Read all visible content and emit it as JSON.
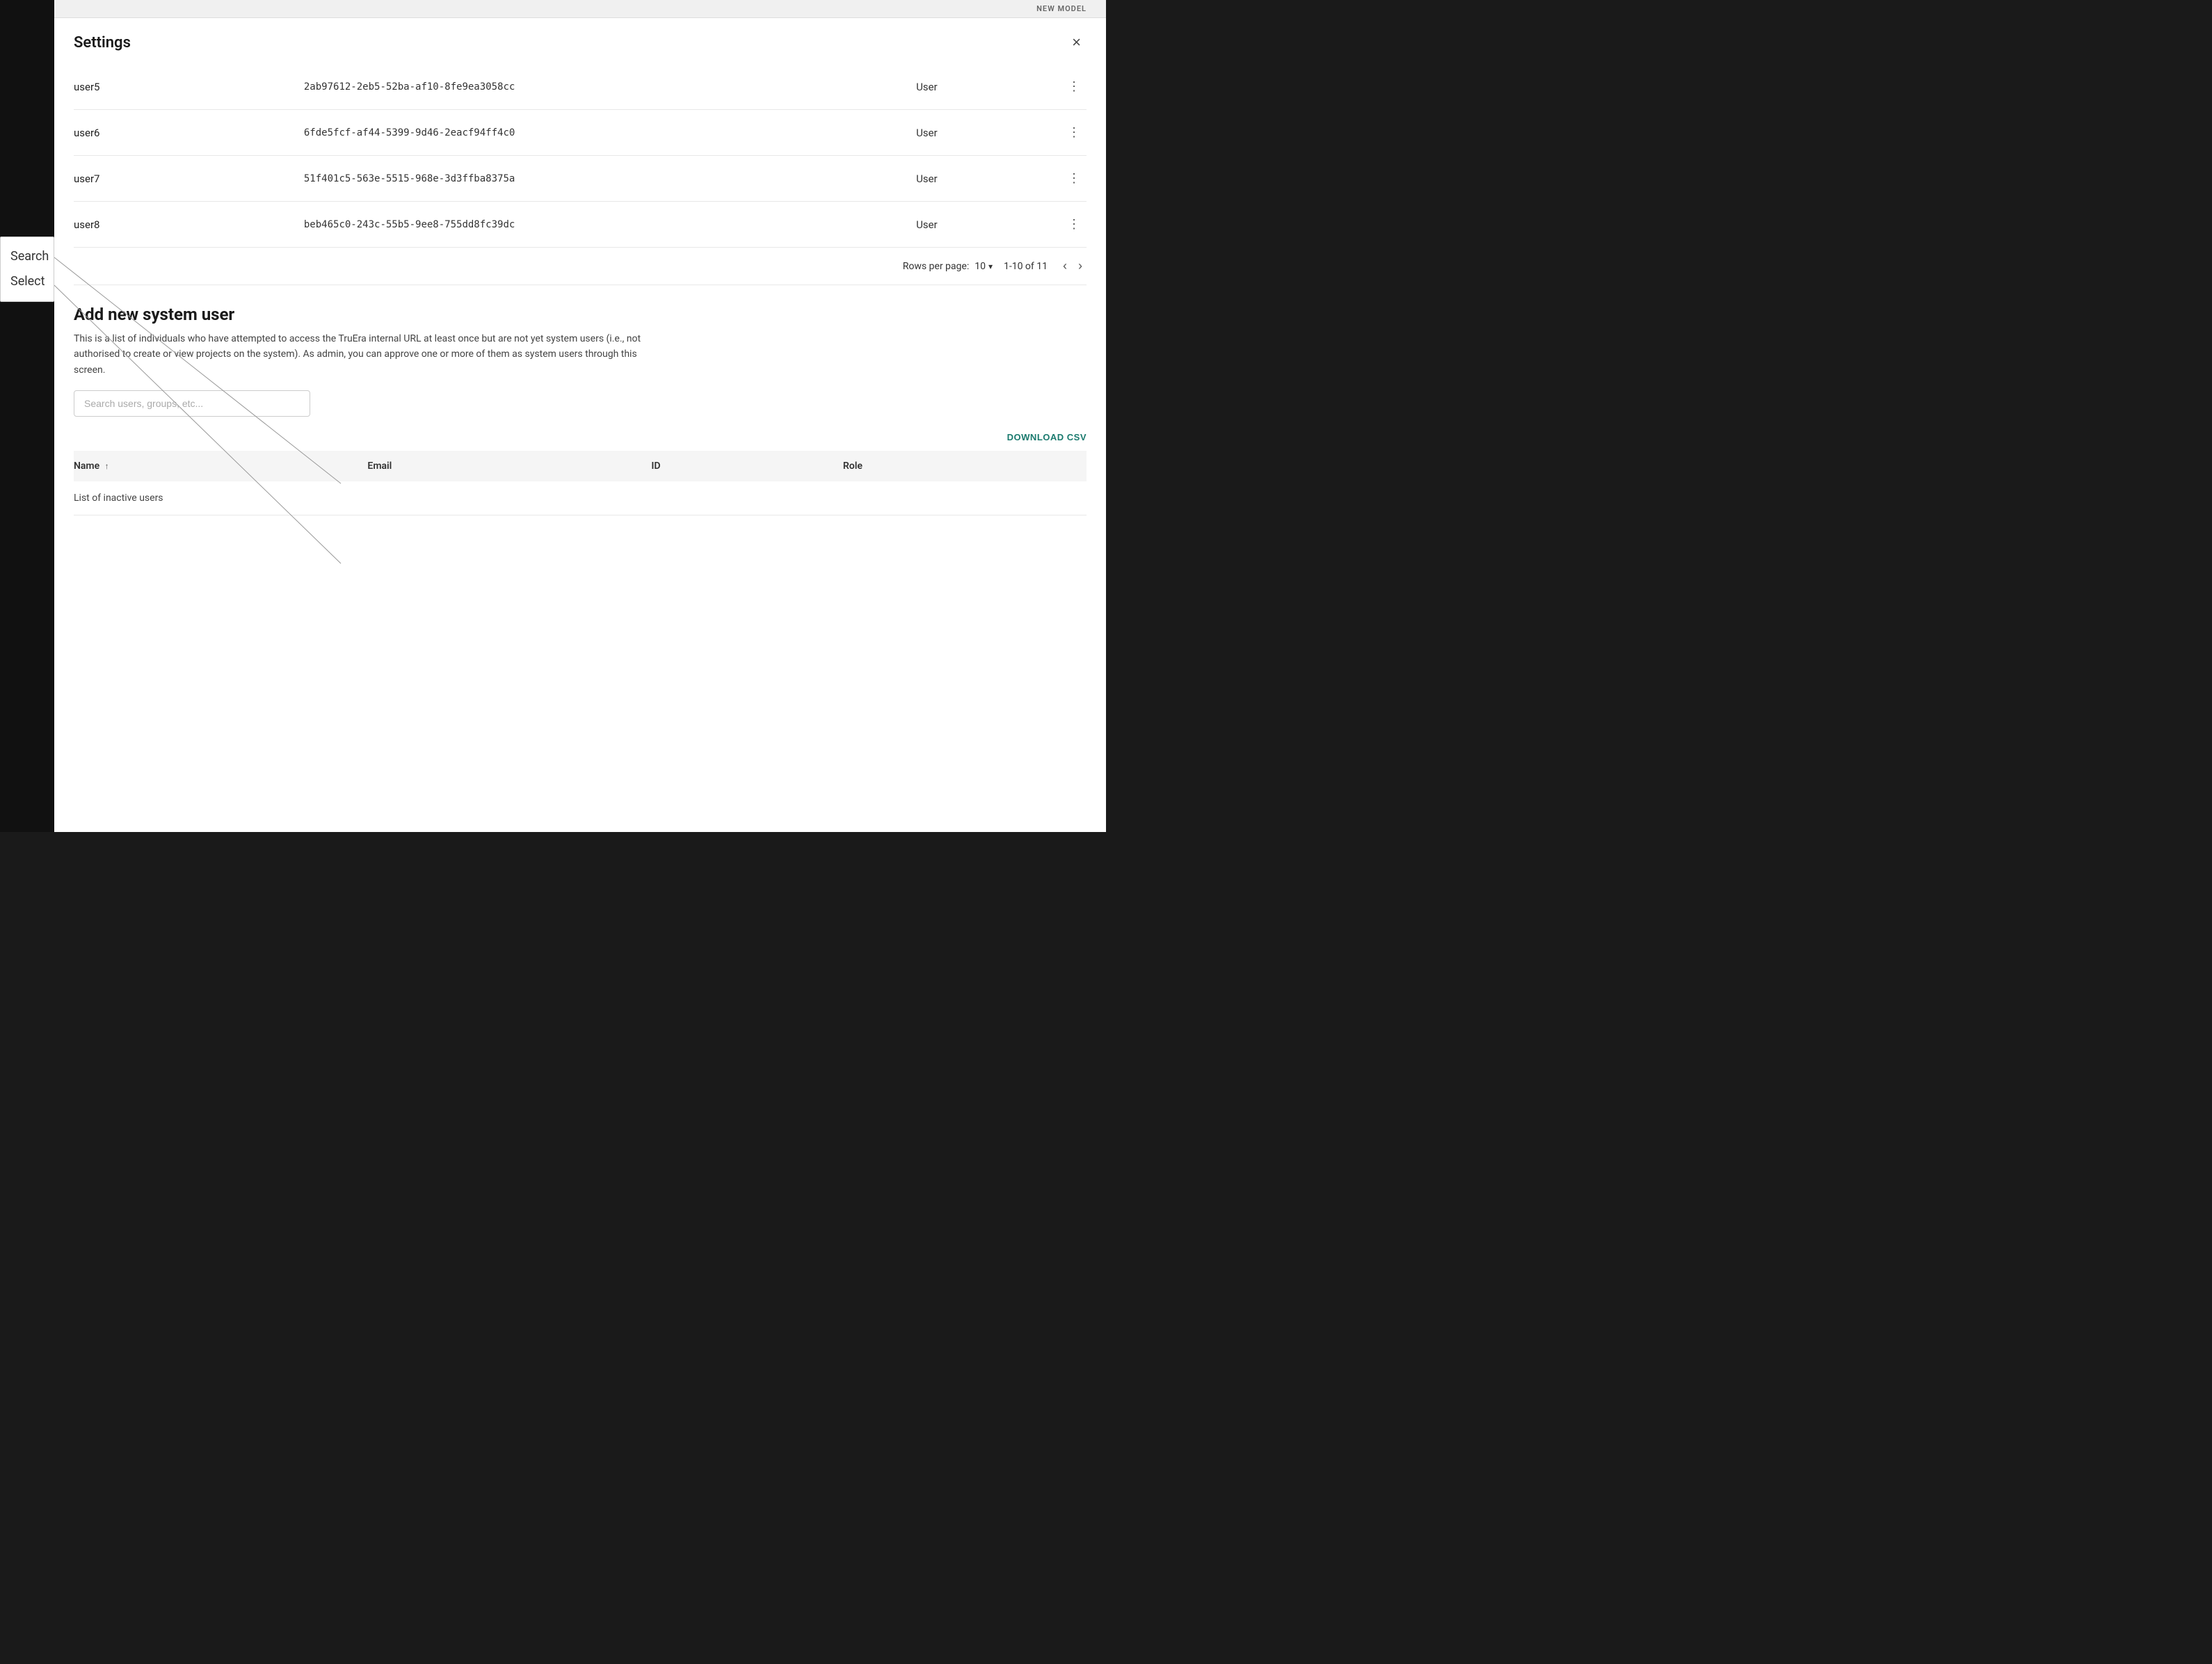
{
  "topbar": {
    "new_model_label": "NEW MODEL"
  },
  "modal": {
    "title": "Settings",
    "close_label": "×"
  },
  "users_table": {
    "rows": [
      {
        "name": "user5",
        "id": "2ab97612-2eb5-52ba-af10-8fe9ea3058cc",
        "role": "User"
      },
      {
        "name": "user6",
        "id": "6fde5fcf-af44-5399-9d46-2eacf94ff4c0",
        "role": "User"
      },
      {
        "name": "user7",
        "id": "51f401c5-563e-5515-968e-3d3ffba8375a",
        "role": "User"
      },
      {
        "name": "user8",
        "id": "beb465c0-243c-55b5-9ee8-755dd8fc39dc",
        "role": "User"
      }
    ]
  },
  "pagination": {
    "rows_per_page_label": "Rows per page:",
    "rows_count": "10",
    "page_info": "1-10 of 11",
    "prev_icon": "‹",
    "next_icon": "›"
  },
  "add_user_section": {
    "title": "Add new system user",
    "description": "This is a list of individuals who have attempted to access the TruEra internal URL at least once but are not yet system users (i.e., not authorised to create or view projects on the system). As admin, you can approve one or more of them as system users through this screen.",
    "search_placeholder": "Search users, groups, etc...",
    "download_csv_label": "DOWNLOAD CSV"
  },
  "inactive_table": {
    "columns": [
      {
        "label": "Name",
        "sort": true
      },
      {
        "label": "Email",
        "sort": false
      },
      {
        "label": "ID",
        "sort": false
      },
      {
        "label": "Role",
        "sort": false
      }
    ],
    "empty_text": "List of inactive users"
  },
  "callout": {
    "search_label": "Search",
    "select_label": "Select"
  }
}
